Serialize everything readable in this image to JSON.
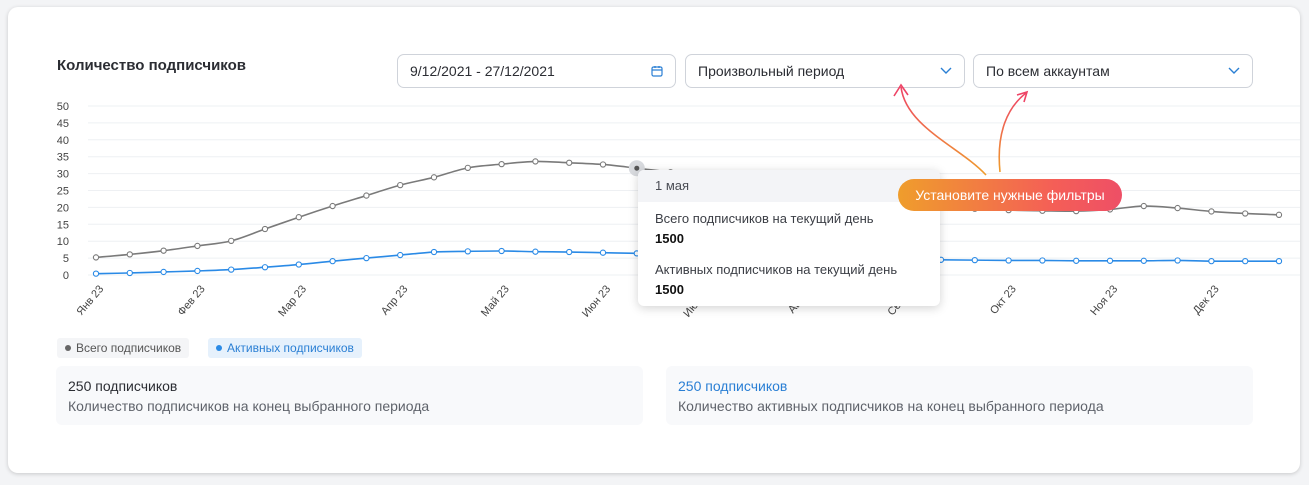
{
  "widget": {
    "title": "Количество подписчиков",
    "date_range": "9/12/2021 - 27/12/2021",
    "period_select": "Произвольный период",
    "account_select": "По всем аккаунтам"
  },
  "legend": {
    "total": "Всего подписчиков",
    "active": "Активных подписчиков"
  },
  "stats": {
    "total_value": "250 подписчиков",
    "total_label": "Количество подписчиков на конец выбранного периода",
    "active_value": "250 подписчиков",
    "active_label": "Количество активных подписчиков на конец выбранного периода"
  },
  "tooltip": {
    "date": "1 мая",
    "total_label": "Всего подписчиков на текущий день",
    "total_value": "1500",
    "active_label": "Активных подписчиков на текущий день",
    "active_value": "1500"
  },
  "hint": "Установите нужные фильтры",
  "colors": {
    "total": "#7a7a7a",
    "active": "#2a8ae6",
    "active_text": "#2a7fd4",
    "legend_active_bg": "#e6f1fc",
    "hint_start": "#ef9d2c",
    "hint_end": "#ee4f66"
  },
  "icons": {
    "date": "calendar-icon",
    "select": "chevron-down-icon"
  },
  "chart_data": {
    "type": "line",
    "categories": [
      "Янв 23",
      "Фев 23",
      "Мар 23",
      "Апр 23",
      "Май 23",
      "Июн 23",
      "Июл 23",
      "Авг 23",
      "Сен 23",
      "Окт 23",
      "Ноя 23",
      "Дек 23"
    ],
    "ylim": [
      0,
      50
    ],
    "yticks": [
      "50",
      "45",
      "40",
      "35",
      "30",
      "25",
      "20",
      "15",
      "10",
      "5",
      "0"
    ],
    "grid": true,
    "legend_position": "bottom-left",
    "series": [
      {
        "name": "Всего подписчиков",
        "values": [
          5.2,
          6.1,
          7.2,
          8.6,
          10.1,
          13.6,
          17.1,
          20.4,
          23.5,
          26.6,
          28.9,
          31.7,
          32.8,
          33.6,
          33.2,
          32.7,
          31.6,
          30.4,
          29,
          27.6,
          26.2,
          24.8,
          23.5,
          22.2,
          21.1,
          20.2,
          19.6,
          19.2,
          19,
          18.9,
          19.4,
          20.4,
          19.8,
          18.8,
          18.2,
          17.8
        ],
        "color": "#7a7a7a"
      },
      {
        "name": "Активных подписчиков",
        "values": [
          0.4,
          0.6,
          0.9,
          1.2,
          1.6,
          2.3,
          3.1,
          4.1,
          5,
          5.9,
          6.8,
          7,
          7.1,
          6.9,
          6.8,
          6.6,
          6.4,
          6.1,
          5.8,
          5.5,
          5.2,
          4.9,
          4.8,
          4.7,
          4.6,
          4.5,
          4.4,
          4.3,
          4.3,
          4.2,
          4.2,
          4.2,
          4.3,
          4.1,
          4.1,
          4.1
        ],
        "color": "#2a8ae6"
      }
    ]
  }
}
